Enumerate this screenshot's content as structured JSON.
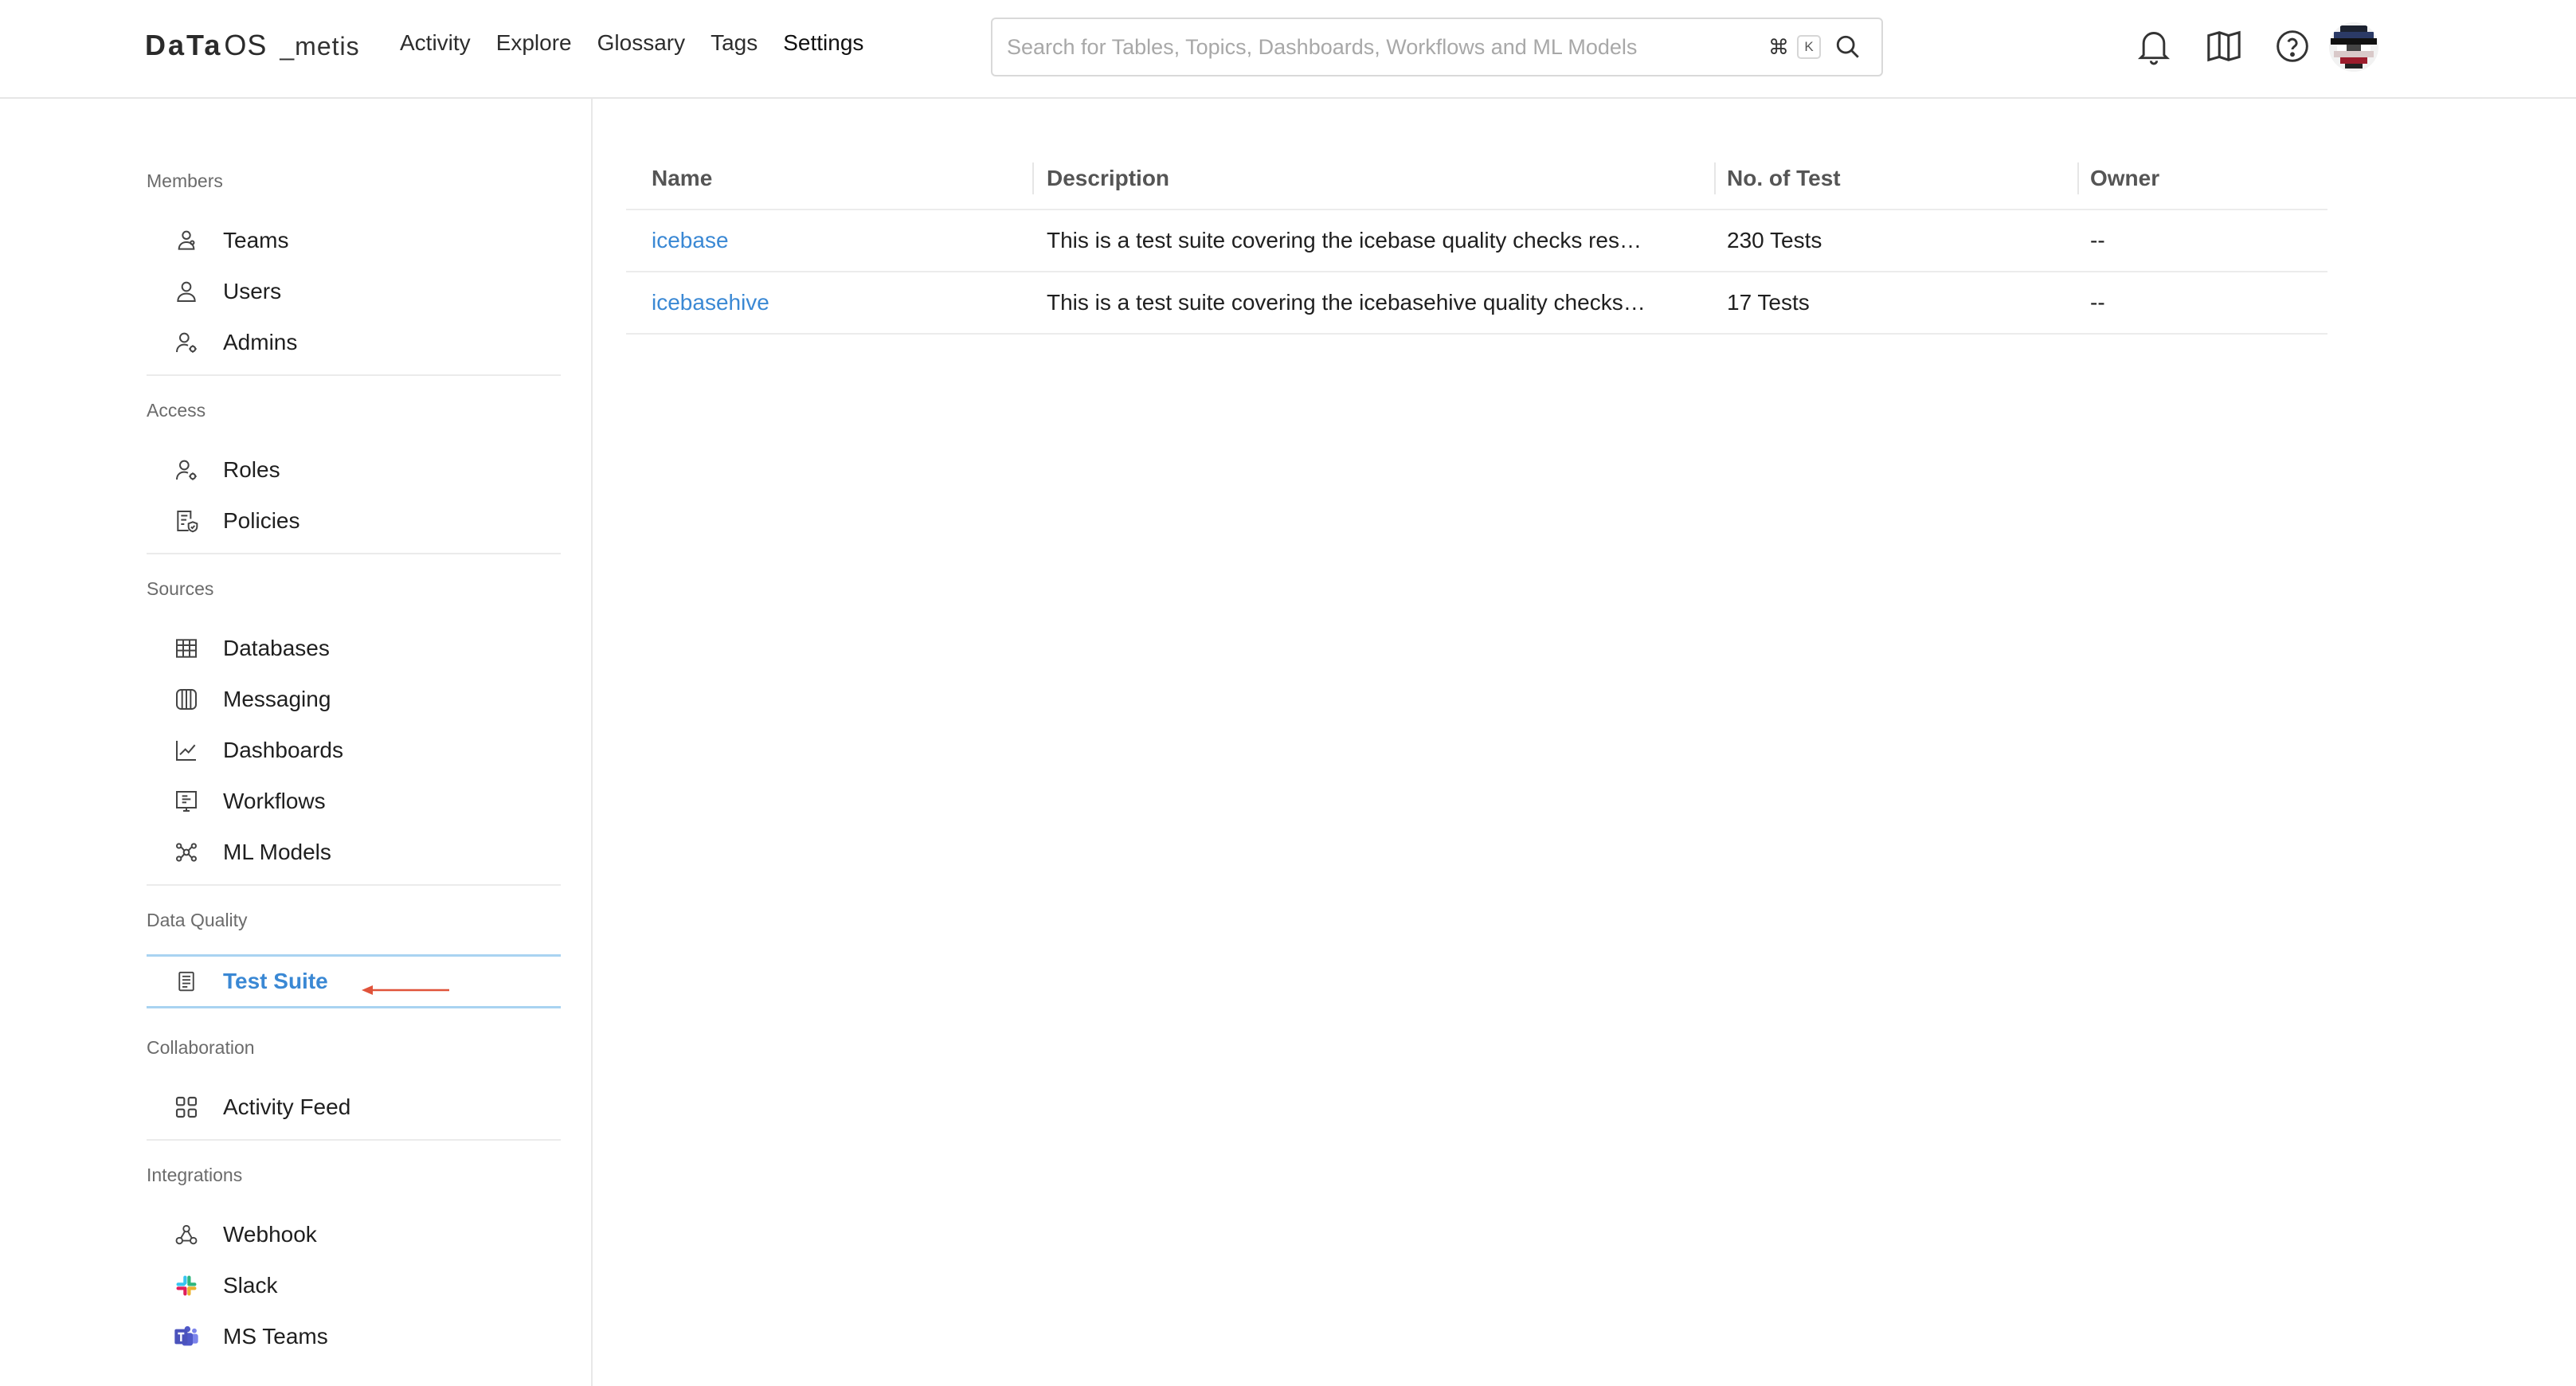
{
  "header": {
    "logo_main": "DaTa",
    "logo_os": "OS",
    "logo_suffix": "_metis",
    "nav": [
      "Activity",
      "Explore",
      "Glossary",
      "Tags",
      "Settings"
    ],
    "active_nav": "Settings",
    "search": {
      "placeholder": "Search for Tables, Topics, Dashboards, Workflows and ML Models",
      "value": "",
      "shortcut_cmd": "⌘",
      "shortcut_key": "K"
    },
    "icons": [
      "bell-icon",
      "map-icon",
      "help-icon",
      "avatar"
    ]
  },
  "sidebar": {
    "members": {
      "title": "Members",
      "items": [
        {
          "label": "Teams",
          "icon": "teams-icon"
        },
        {
          "label": "Users",
          "icon": "user-icon"
        },
        {
          "label": "Admins",
          "icon": "admin-icon"
        }
      ]
    },
    "access": {
      "title": "Access",
      "items": [
        {
          "label": "Roles",
          "icon": "roles-icon"
        },
        {
          "label": "Policies",
          "icon": "policies-icon"
        }
      ]
    },
    "sources": {
      "title": "Sources",
      "items": [
        {
          "label": "Databases",
          "icon": "table-icon"
        },
        {
          "label": "Messaging",
          "icon": "messaging-icon"
        },
        {
          "label": "Dashboards",
          "icon": "chart-line-icon"
        },
        {
          "label": "Workflows",
          "icon": "workflow-icon"
        },
        {
          "label": "ML Models",
          "icon": "ml-model-icon"
        }
      ]
    },
    "data_quality": {
      "title": "Data Quality",
      "items": [
        {
          "label": "Test Suite",
          "icon": "document-list-icon",
          "active": true
        }
      ]
    },
    "collaboration": {
      "title": "Collaboration",
      "items": [
        {
          "label": "Activity Feed",
          "icon": "grid-icon"
        }
      ]
    },
    "integrations": {
      "title": "Integrations",
      "items": [
        {
          "label": "Webhook",
          "icon": "webhook-icon"
        },
        {
          "label": "Slack",
          "icon": "slack-icon"
        },
        {
          "label": "MS Teams",
          "icon": "ms-teams-icon"
        }
      ]
    }
  },
  "table": {
    "columns": [
      "Name",
      "Description",
      "No. of Test",
      "Owner"
    ],
    "rows": [
      {
        "name": "icebase",
        "description": "This is a test suite covering the icebase quality checks res…",
        "tests": "230 Tests",
        "owner": "--"
      },
      {
        "name": "icebasehive",
        "description": "This is a test suite covering the icebasehive quality checks…",
        "tests": "17 Tests",
        "owner": "--"
      }
    ]
  },
  "colors": {
    "accent": "#3a88d4",
    "active_border": "#a9d3f1",
    "annotation_arrow": "#e0533a"
  }
}
